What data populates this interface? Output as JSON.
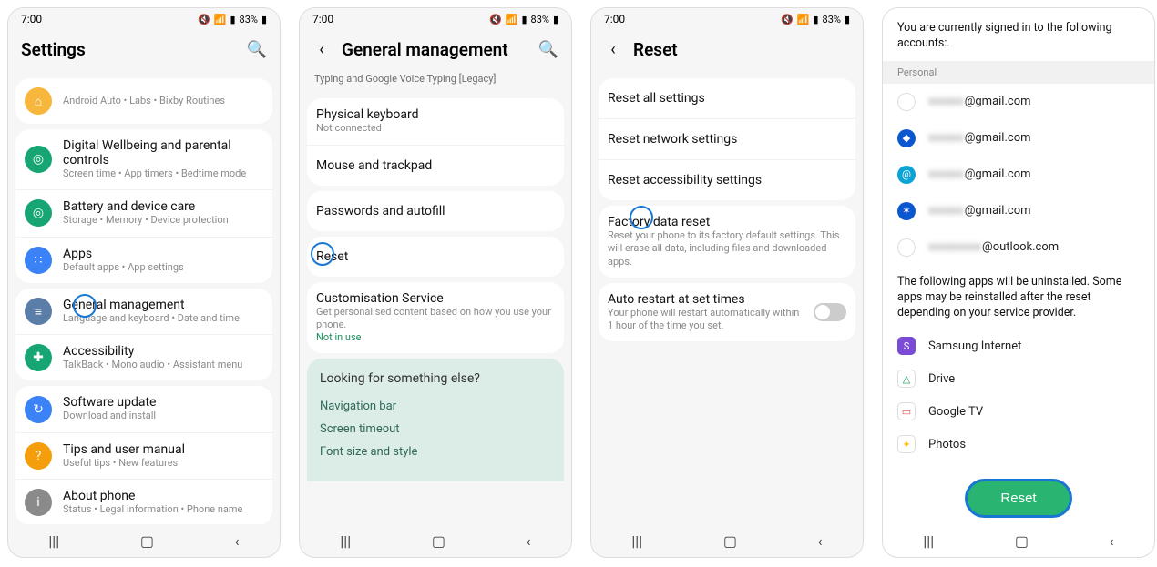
{
  "status": {
    "time": "7:00",
    "battery": "83%"
  },
  "nav": {
    "recents": "|||",
    "home": "▢",
    "back": "‹"
  },
  "screen1": {
    "title": "Settings",
    "items": [
      {
        "bg": "bg-yellow",
        "glyph": "⌂",
        "title": "",
        "sub": "Android Auto  •  Labs  •  Bixby Routines"
      },
      {
        "bg": "bg-green",
        "glyph": "◎",
        "title": "Digital Wellbeing and parental controls",
        "sub": "Screen time  •  App timers  •  Bedtime mode"
      },
      {
        "bg": "bg-teal",
        "glyph": "◎",
        "title": "Battery and device care",
        "sub": "Storage  •  Memory  •  Device protection"
      },
      {
        "bg": "bg-blue",
        "glyph": "∷",
        "title": "Apps",
        "sub": "Default apps  •  App settings"
      },
      {
        "bg": "bg-bluegrey",
        "glyph": "≡",
        "title": "General management",
        "sub": "Language and keyboard  •  Date and time",
        "highlight": true
      },
      {
        "bg": "bg-green",
        "glyph": "✚",
        "title": "Accessibility",
        "sub": "TalkBack  •  Mono audio  •  Assistant menu"
      },
      {
        "bg": "bg-blue",
        "glyph": "↻",
        "title": "Software update",
        "sub": "Download and install"
      },
      {
        "bg": "bg-orange",
        "glyph": "?",
        "title": "Tips and user manual",
        "sub": "Useful tips  •  New features"
      },
      {
        "bg": "bg-grey",
        "glyph": "i",
        "title": "About phone",
        "sub": "Status  •  Legal information  •  Phone name"
      }
    ]
  },
  "screen2": {
    "title": "General management",
    "top_sub": "Typing and Google Voice Typing [Legacy]",
    "rows": [
      {
        "title": "Physical keyboard",
        "sub": "Not connected"
      },
      {
        "title": "Mouse and trackpad"
      },
      {
        "title": "Passwords and autofill"
      },
      {
        "title": "Reset",
        "highlight": true
      },
      {
        "title": "Customisation Service",
        "sub": "Get personalised content based on how you use your phone.",
        "sub2": "Not in use"
      }
    ],
    "looking": {
      "header": "Looking for something else?",
      "links": [
        "Navigation bar",
        "Screen timeout",
        "Font size and style"
      ]
    }
  },
  "screen3": {
    "title": "Reset",
    "rows": [
      {
        "title": "Reset all settings"
      },
      {
        "title": "Reset network settings"
      },
      {
        "title": "Reset accessibility settings"
      },
      {
        "title": "Factory data reset",
        "sub": "Reset your phone to its factory default settings. This will erase all data, including files and downloaded apps.",
        "highlight": true
      },
      {
        "title": "Auto restart at set times",
        "sub": "Your phone will restart automatically within 1 hour of the time you set.",
        "toggle": true
      }
    ]
  },
  "screen4": {
    "intro": "You are currently signed in to the following accounts:.",
    "personal": "Personal",
    "accounts": [
      {
        "bg": "bg-google",
        "glyph": "G",
        "blur": "xxxxxx",
        "domain": "@gmail.com"
      },
      {
        "bg": "bg-navy",
        "glyph": "◆",
        "blur": "xxxxxx",
        "domain": "@gmail.com"
      },
      {
        "bg": "bg-cyan",
        "glyph": "@",
        "blur": "xxxxxx",
        "domain": "@gmail.com"
      },
      {
        "bg": "bg-navy",
        "glyph": "✶",
        "blur": "xxxxxx",
        "domain": "@gmail.com"
      },
      {
        "bg": "bg-onedrive",
        "glyph": "☁",
        "blur": "xxxxxxxxx",
        "domain": "@outlook.com"
      }
    ],
    "apps_intro": "The following apps will be uninstalled. Some apps may be reinstalled after the reset depending on your service provider.",
    "apps": [
      {
        "bg": "bg-si",
        "glyph": "S",
        "name": "Samsung Internet"
      },
      {
        "bg": "bg-drive",
        "glyph": "△",
        "name": "Drive"
      },
      {
        "bg": "bg-gtv",
        "glyph": "▭",
        "name": "Google TV"
      },
      {
        "bg": "bg-photos",
        "glyph": "✦",
        "name": "Photos"
      }
    ],
    "reset": "Reset"
  }
}
